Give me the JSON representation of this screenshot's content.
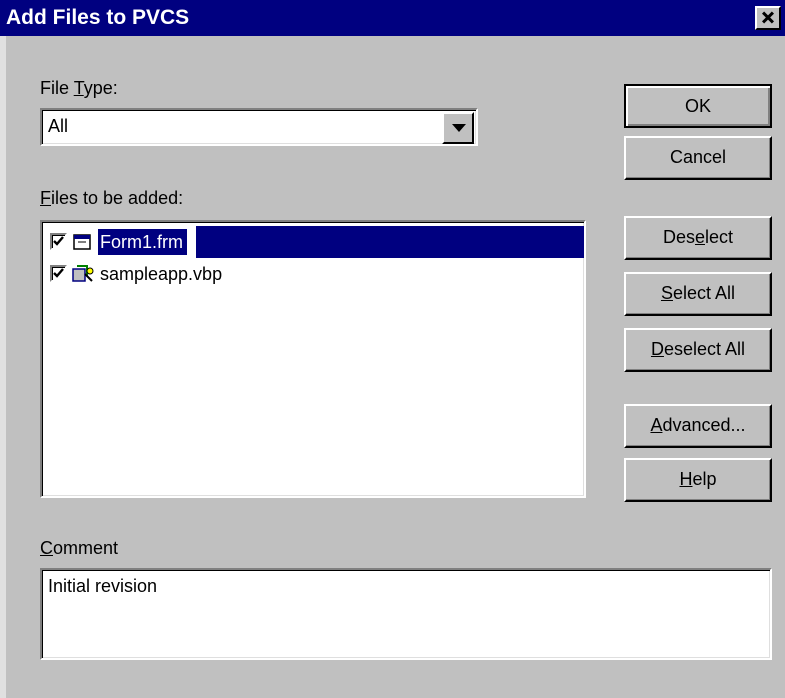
{
  "window": {
    "title": "Add Files to PVCS"
  },
  "file_type": {
    "label_pre": "File ",
    "label_accel": "T",
    "label_post": "ype:",
    "value": "All"
  },
  "files": {
    "label_accel": "F",
    "label_post": "iles to be added:",
    "items": [
      {
        "name": "Form1.frm",
        "checked": true,
        "selected": true,
        "icon": "form-file-icon"
      },
      {
        "name": "sampleapp.vbp",
        "checked": true,
        "selected": false,
        "icon": "vb-project-icon"
      }
    ]
  },
  "buttons": {
    "ok": "OK",
    "cancel": "Cancel",
    "deselect_pre": "Des",
    "deselect_accel": "e",
    "deselect_post": "lect",
    "select_all_accel": "S",
    "select_all_post": "elect All",
    "deselect_all_accel": "D",
    "deselect_all_post": "eselect All",
    "advanced_accel": "A",
    "advanced_post": "dvanced...",
    "help_accel": "H",
    "help_post": "elp"
  },
  "comment": {
    "label_accel": "C",
    "label_post": "omment",
    "value": "Initial revision"
  }
}
